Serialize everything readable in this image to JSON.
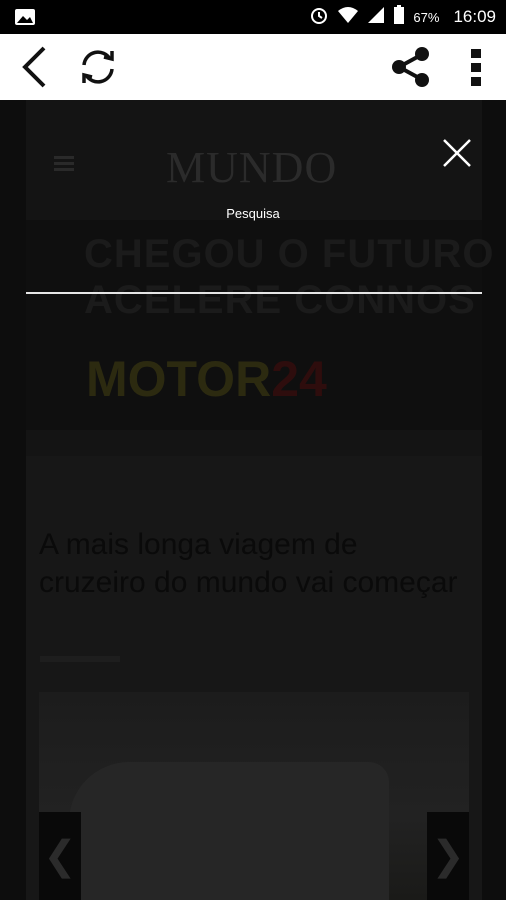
{
  "status_bar": {
    "battery_percent": "67%",
    "time": "16:09",
    "icons": [
      "image-icon",
      "alarm-icon",
      "wifi-icon",
      "signal-icon",
      "battery-icon"
    ]
  },
  "toolbar": {
    "icons": [
      "back-icon",
      "refresh-icon",
      "share-icon",
      "more-vert-icon"
    ]
  },
  "background_page": {
    "logo": "MUNDO",
    "banner_line1": "CHEGOU O FUTURO",
    "banner_line2": "ACELERE CONNOS",
    "brand": "MOTOR",
    "brand_suffix": "24",
    "article_title": "A mais longa viagem de cruzeiro do mundo vai começar",
    "prev_arrow": "❮",
    "next_arrow": "❯"
  },
  "search_overlay": {
    "label": "Pesquisa",
    "input_value": ""
  },
  "colors": {
    "accent": "#ffffff",
    "overlay": "#000000"
  }
}
